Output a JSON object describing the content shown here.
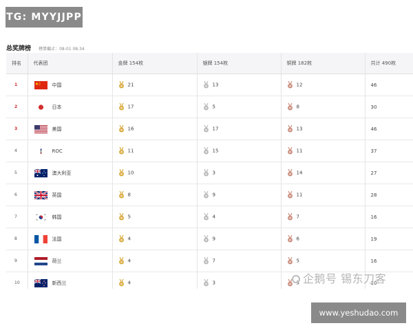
{
  "tg_badge": "TG: MYYJJPP",
  "site_badge": "www.yeshudao.com",
  "watermark": "企鹅号 锡东刀客",
  "heading": {
    "title": "总奖牌榜",
    "deadline": "榜单截止：08-01 08:34"
  },
  "columns": {
    "rank": "排名",
    "team": "代表团",
    "gold": "金牌 154枚",
    "silver": "银牌 154枚",
    "bronze": "铜牌 182枚",
    "total": "共计 490枚"
  },
  "colors": {
    "gold_medal": "#d9a93a",
    "silver_medal": "#b8b8b8",
    "bronze_medal": "#c98a7a",
    "top_rank": "#cc2b2b"
  },
  "rows": [
    {
      "rank": "1",
      "flag": "china-flag-icon",
      "team": "中国",
      "gold": "21",
      "silver": "13",
      "bronze": "12",
      "total": "46"
    },
    {
      "rank": "2",
      "flag": "japan-flag-icon",
      "team": "日本",
      "gold": "17",
      "silver": "5",
      "bronze": "8",
      "total": "30"
    },
    {
      "rank": "3",
      "flag": "usa-flag-icon",
      "team": "美国",
      "gold": "16",
      "silver": "17",
      "bronze": "13",
      "total": "46"
    },
    {
      "rank": "4",
      "flag": "roc-flag-icon",
      "team": "ROC",
      "gold": "11",
      "silver": "15",
      "bronze": "11",
      "total": "37"
    },
    {
      "rank": "5",
      "flag": "australia-flag-icon",
      "team": "澳大利亚",
      "gold": "10",
      "silver": "3",
      "bronze": "14",
      "total": "27"
    },
    {
      "rank": "6",
      "flag": "uk-flag-icon",
      "team": "英国",
      "gold": "8",
      "silver": "9",
      "bronze": "11",
      "total": "28"
    },
    {
      "rank": "7",
      "flag": "korea-flag-icon",
      "team": "韩国",
      "gold": "5",
      "silver": "4",
      "bronze": "7",
      "total": "16"
    },
    {
      "rank": "8",
      "flag": "france-flag-icon",
      "team": "法国",
      "gold": "4",
      "silver": "9",
      "bronze": "6",
      "total": "19"
    },
    {
      "rank": "9",
      "flag": "netherlands-flag-icon",
      "team": "荷兰",
      "gold": "4",
      "silver": "7",
      "bronze": "5",
      "total": "16"
    },
    {
      "rank": "10",
      "flag": "newzealand-flag-icon",
      "team": "新西兰",
      "gold": "4",
      "silver": "3",
      "bronze": "3",
      "total": "10"
    }
  ]
}
